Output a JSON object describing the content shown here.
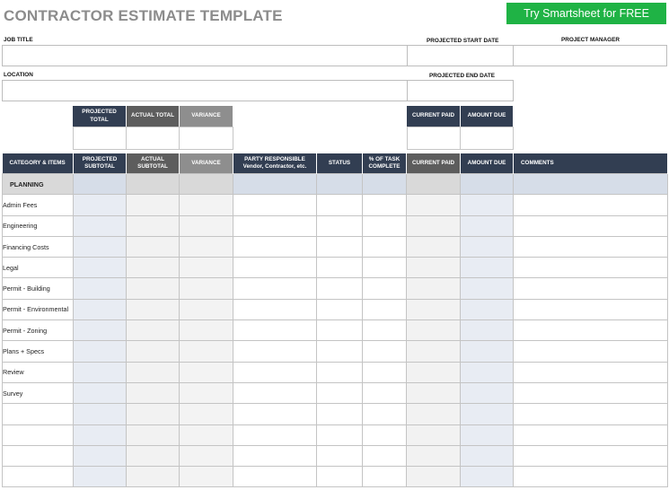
{
  "header": {
    "title": "CONTRACTOR ESTIMATE TEMPLATE",
    "cta_label": "Try Smartsheet for FREE"
  },
  "fields": {
    "job_title": "JOB TITLE",
    "projected_start_date": "PROJECTED START DATE",
    "project_manager": "PROJECT MANAGER",
    "location": "LOCATION",
    "projected_end_date": "PROJECTED END DATE"
  },
  "summary": {
    "projected_total": "PROJECTED TOTAL",
    "actual_total": "ACTUAL TOTAL",
    "variance": "VARIANCE",
    "current_paid": "CURRENT PAID",
    "amount_due": "AMOUNT DUE"
  },
  "table": {
    "columns": [
      "CATEGORY & ITEMS",
      "PROJECTED SUBTOTAL",
      "ACTUAL SUBTOTAL",
      "VARIANCE",
      "PARTY RESPONSIBLE Vendor, Contractor, etc.",
      "STATUS",
      "% OF TASK COMPLETE",
      "CURRENT PAID",
      "AMOUNT DUE",
      "COMMENTS"
    ],
    "section": "PLANNING",
    "rows": [
      "Admin Fees",
      "Engineering",
      "Financing Costs",
      "Legal",
      "Permit - Building",
      "Permit - Environmental",
      "Permit - Zoning",
      "Plans + Specs",
      "Review",
      "Survey",
      "",
      "",
      "",
      ""
    ]
  },
  "colors": {
    "title": "#8c8c8c",
    "cta": "#1fb345",
    "header_dark": "#323e52",
    "header_mid": "#5d5d5d",
    "header_grey": "#8e8e8e",
    "shade_blue": "#e8ecf3",
    "shade_grey": "#f2f2f2",
    "section_bg": "#d9d9d9"
  }
}
